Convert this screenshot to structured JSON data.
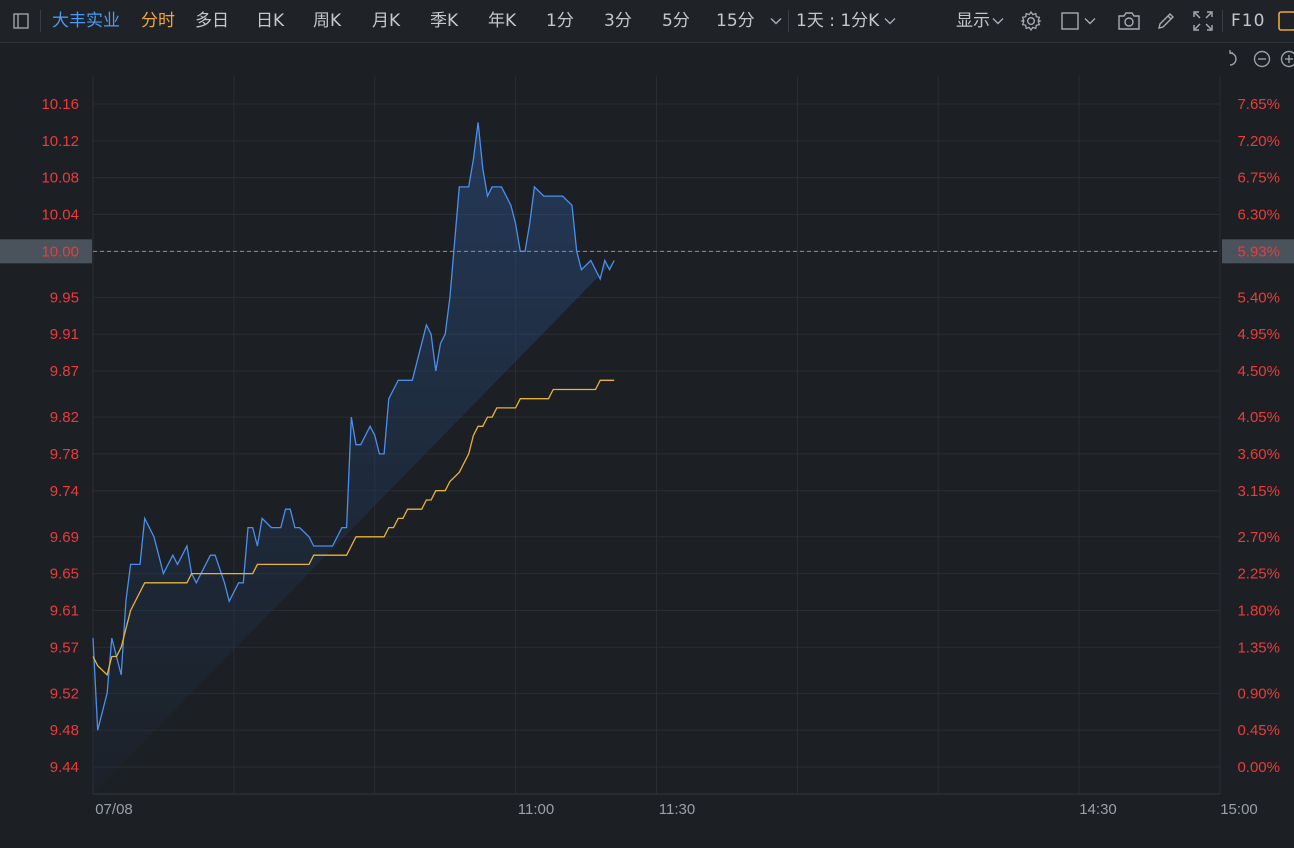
{
  "toolbar": {
    "stock_name": "大丰实业",
    "periods": [
      "分时",
      "多日",
      "日K",
      "周K",
      "月K",
      "季K",
      "年K",
      "1分",
      "3分",
      "5分",
      "15分"
    ],
    "active_period": "分时",
    "interval_label": "1天 : 1分K",
    "display_label": "显示",
    "f10_label": "F10"
  },
  "colors": {
    "background": "#1c1f23",
    "price_line": "#4a8fee",
    "avg_line": "#e8b23c",
    "axis_red": "#ec3b3b",
    "grid": "#2a2e33",
    "active_name": "#4a9bf5",
    "active_period": "#f0a63a"
  },
  "chart_data": {
    "type": "line",
    "title": "",
    "date_label": "07/08",
    "x_tick_labels": [
      "07/08",
      "11:00",
      "11:30",
      "14:30",
      "15:00"
    ],
    "y_tick_labels": [
      "10.16",
      "10.12",
      "10.08",
      "10.04",
      "10.00",
      "9.95",
      "9.91",
      "9.87",
      "9.82",
      "9.78",
      "9.74",
      "9.69",
      "9.65",
      "9.61",
      "9.57",
      "9.52",
      "9.48",
      "9.44"
    ],
    "pct_tick_labels": [
      "7.65%",
      "7.20%",
      "6.75%",
      "6.30%",
      "5.93%",
      "5.40%",
      "4.95%",
      "4.50%",
      "4.05%",
      "3.60%",
      "3.15%",
      "2.70%",
      "2.25%",
      "1.80%",
      "1.35%",
      "0.90%",
      "0.45%",
      "0.00%"
    ],
    "current_price_label": "10.00",
    "current_pct_label": "5.93%",
    "ylim": [
      9.44,
      10.16
    ],
    "x": [
      "09:30",
      "09:31",
      "09:33",
      "09:34",
      "09:35",
      "09:36",
      "09:37",
      "09:38",
      "09:40",
      "09:41",
      "09:43",
      "09:44",
      "09:45",
      "09:47",
      "09:48",
      "09:50",
      "09:51",
      "09:52",
      "09:54",
      "09:55",
      "09:56",
      "09:58",
      "09:59",
      "10:01",
      "10:02",
      "10:03",
      "10:04",
      "10:05",
      "10:06",
      "10:08",
      "10:10",
      "10:11",
      "10:12",
      "10:13",
      "10:14",
      "10:16",
      "10:17",
      "10:18",
      "10:20",
      "10:21",
      "10:23",
      "10:24",
      "10:25",
      "10:26",
      "10:27",
      "10:29",
      "10:30",
      "10:31",
      "10:32",
      "10:33",
      "10:34",
      "10:35",
      "10:36",
      "10:37",
      "10:38",
      "10:40",
      "10:41",
      "10:42",
      "10:43",
      "10:44",
      "10:45",
      "10:46",
      "10:48",
      "10:49",
      "10:50",
      "10:51",
      "10:52",
      "10:53",
      "10:54",
      "10:55",
      "10:56",
      "10:57",
      "10:58",
      "10:59",
      "11:00",
      "11:01",
      "11:02",
      "11:03",
      "11:04",
      "11:06",
      "11:07",
      "11:08",
      "11:09",
      "11:10",
      "11:12",
      "11:13",
      "11:14",
      "11:16",
      "11:17",
      "11:18",
      "11:19",
      "11:20",
      "11:21",
      "11:22",
      "11:23"
    ],
    "series": [
      {
        "values": [
          9.58,
          9.48,
          9.52,
          9.58,
          9.56,
          9.54,
          9.62,
          9.66,
          9.66,
          9.71,
          9.69,
          9.67,
          9.65,
          9.67,
          9.66,
          9.68,
          9.65,
          9.64,
          9.66,
          9.67,
          9.67,
          9.64,
          9.62,
          9.64,
          9.64,
          9.7,
          9.7,
          9.68,
          9.71,
          9.7,
          9.7,
          9.72,
          9.72,
          9.7,
          9.7,
          9.69,
          9.68,
          9.68,
          9.68,
          9.68,
          9.7,
          9.7,
          9.82,
          9.79,
          9.79,
          9.81,
          9.8,
          9.78,
          9.78,
          9.84,
          9.85,
          9.86,
          9.86,
          9.86,
          9.86,
          9.9,
          9.92,
          9.91,
          9.87,
          9.9,
          9.91,
          9.95,
          10.07,
          10.07,
          10.07,
          10.1,
          10.14,
          10.09,
          10.06,
          10.07,
          10.07,
          10.07,
          10.06,
          10.05,
          10.03,
          10.0,
          10.0,
          10.03,
          10.07,
          10.06,
          10.06,
          10.06,
          10.06,
          10.06,
          10.05,
          10.0,
          9.98,
          9.99,
          9.98,
          9.97,
          9.99,
          9.98,
          9.99
        ]
      },
      {
        "values": [
          9.56,
          9.55,
          9.54,
          9.56,
          9.56,
          9.57,
          9.59,
          9.61,
          9.63,
          9.64,
          9.64,
          9.64,
          9.64,
          9.64,
          9.64,
          9.64,
          9.65,
          9.65,
          9.65,
          9.65,
          9.65,
          9.65,
          9.65,
          9.65,
          9.65,
          9.65,
          9.65,
          9.66,
          9.66,
          9.66,
          9.66,
          9.66,
          9.66,
          9.66,
          9.66,
          9.66,
          9.67,
          9.67,
          9.67,
          9.67,
          9.67,
          9.67,
          9.68,
          9.69,
          9.69,
          9.69,
          9.69,
          9.69,
          9.69,
          9.7,
          9.7,
          9.71,
          9.71,
          9.72,
          9.72,
          9.72,
          9.73,
          9.73,
          9.74,
          9.74,
          9.74,
          9.75,
          9.76,
          9.77,
          9.78,
          9.8,
          9.81,
          9.81,
          9.82,
          9.82,
          9.83,
          9.83,
          9.83,
          9.83,
          9.83,
          9.84,
          9.84,
          9.84,
          9.84,
          9.84,
          9.84,
          9.85,
          9.85,
          9.85,
          9.85,
          9.85,
          9.85,
          9.85,
          9.85,
          9.86,
          9.86,
          9.86,
          9.86
        ]
      }
    ]
  }
}
